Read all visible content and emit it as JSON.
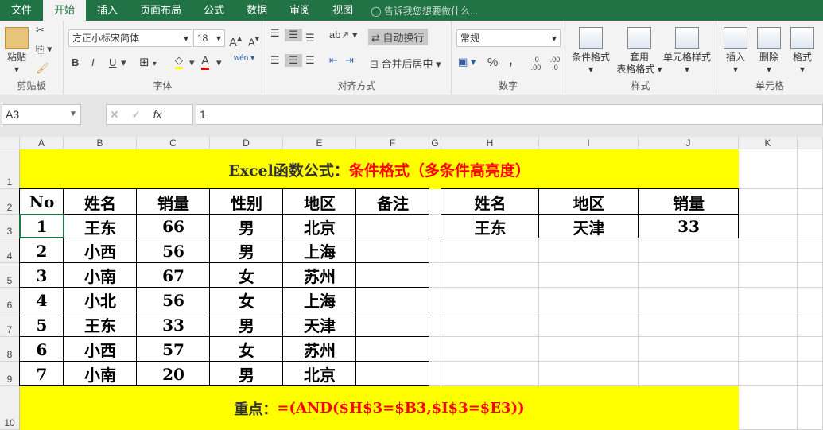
{
  "tabs": [
    "文件",
    "开始",
    "插入",
    "页面布局",
    "公式",
    "数据",
    "审阅",
    "视图"
  ],
  "tell_me": "告诉我您想要做什么...",
  "ribbon": {
    "clipboard": {
      "paste": "粘贴",
      "label": "剪贴板"
    },
    "font": {
      "name": "方正小标宋简体",
      "size": "18",
      "label": "字体",
      "bold": "B",
      "italic": "I",
      "underline": "U",
      "grow": "A",
      "shrink": "A",
      "font_color": "A",
      "phonetic": "wén"
    },
    "alignment": {
      "wrap": "自动换行",
      "merge": "合并后居中",
      "label": "对齐方式"
    },
    "number": {
      "format": "常规",
      "percent": "%",
      "comma": ",",
      "label": "数字",
      "inc": ".0 .00",
      "dec": ".00 .0"
    },
    "styles": {
      "cond": "条件格式",
      "table1": "套用",
      "table2": "表格格式",
      "cell": "单元格样式",
      "label": "样式"
    },
    "cells": {
      "insert": "插入",
      "delete": "删除",
      "format": "格式",
      "label": "单元格"
    }
  },
  "formula_bar": {
    "name_box": "A3",
    "fx": "fx",
    "value": "1"
  },
  "columns": [
    "A",
    "B",
    "C",
    "D",
    "E",
    "F",
    "G",
    "H",
    "I",
    "J",
    "K"
  ],
  "rows": [
    "1",
    "2",
    "3",
    "4",
    "5",
    "6",
    "7",
    "8",
    "9",
    "10"
  ],
  "title": {
    "black": "Excel函数公式：",
    "red": "条件格式（多条件高亮度）"
  },
  "table": {
    "headers": [
      "No",
      "姓名",
      "销量",
      "性别",
      "地区",
      "备注"
    ],
    "rows": [
      [
        "1",
        "王东",
        "66",
        "男",
        "北京",
        ""
      ],
      [
        "2",
        "小西",
        "56",
        "男",
        "上海",
        ""
      ],
      [
        "3",
        "小南",
        "67",
        "女",
        "苏州",
        ""
      ],
      [
        "4",
        "小北",
        "56",
        "女",
        "上海",
        ""
      ],
      [
        "5",
        "王东",
        "33",
        "男",
        "天津",
        ""
      ],
      [
        "6",
        "小西",
        "57",
        "女",
        "苏州",
        ""
      ],
      [
        "7",
        "小南",
        "20",
        "男",
        "北京",
        ""
      ]
    ]
  },
  "criteria": {
    "headers": [
      "姓名",
      "地区",
      "销量"
    ],
    "values": [
      "王东",
      "天津",
      "33"
    ]
  },
  "note": {
    "black": "重点：",
    "red": "=(AND($H$3=$B3,$I$3=$E3))"
  }
}
